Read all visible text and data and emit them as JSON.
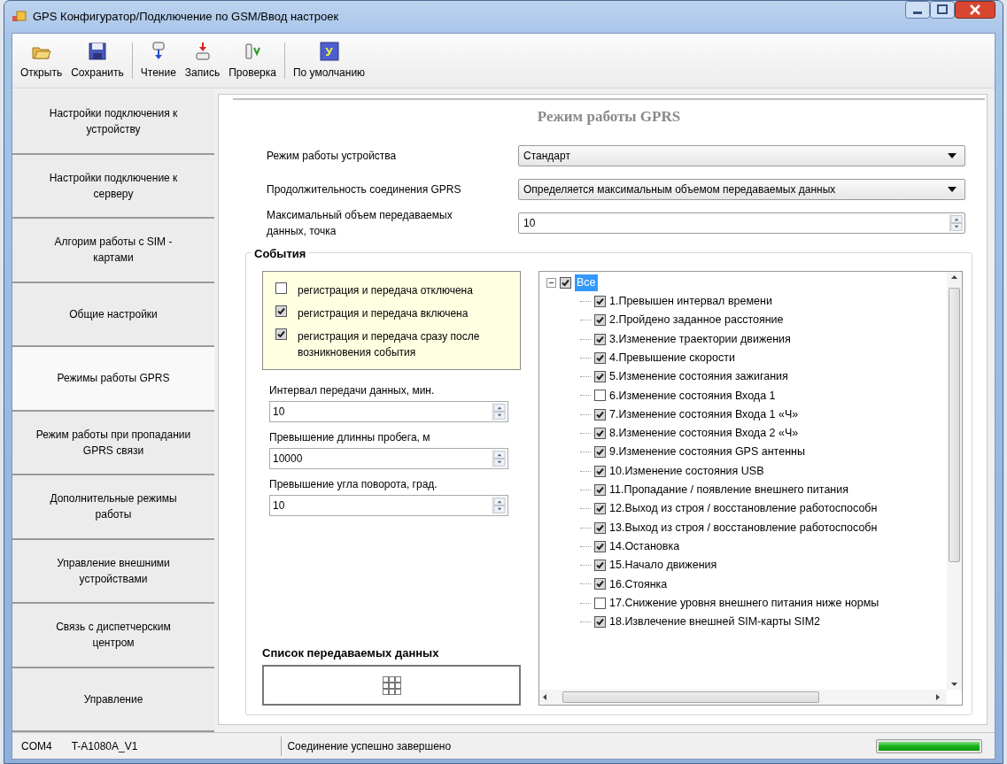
{
  "window": {
    "title": "GPS Конфигуратор/Подключение по GSM/Ввод настроек"
  },
  "toolbar": [
    {
      "kind": "open",
      "label": "Открыть"
    },
    {
      "kind": "save",
      "label": "Сохранить"
    },
    {
      "kind": "separator"
    },
    {
      "kind": "read",
      "label": "Чтение"
    },
    {
      "kind": "write",
      "label": "Запись"
    },
    {
      "kind": "check",
      "label": "Проверка"
    },
    {
      "kind": "separator"
    },
    {
      "kind": "default",
      "label": "По умолчанию",
      "icon_letter": "У"
    }
  ],
  "sidebar": {
    "items": [
      {
        "label": "Настройки подключения к устройству",
        "selected": false
      },
      {
        "label": "Настройки подключение к серверу",
        "selected": false
      },
      {
        "label": "Алгорим работы  с SIM - картами",
        "selected": false
      },
      {
        "label": "Общие настройки",
        "selected": false
      },
      {
        "label": "Режимы работы GPRS",
        "selected": true
      },
      {
        "label": "Режим работы при пропадании GPRS связи",
        "selected": false
      },
      {
        "label": "Дополнительные  режимы работы",
        "selected": false
      },
      {
        "label": "Управление внешними устройствами",
        "selected": false
      },
      {
        "label": "Связь с диспетчерским центром",
        "selected": false
      },
      {
        "label": "Управление",
        "selected": false
      }
    ]
  },
  "panel": {
    "title": "Режим работы GPRS",
    "settings": [
      {
        "kind": "select",
        "label": "Режим работы устройства",
        "value": "Стандарт"
      },
      {
        "kind": "select",
        "label": "Продолжительность соединения GPRS",
        "value": "Определяется максимальным объемом передаваемых данных"
      },
      {
        "kind": "spin",
        "label": "Максимальный объем передаваемых данных, точка",
        "value": "10"
      }
    ],
    "events": {
      "title": "События",
      "modes": [
        {
          "label": "регистрация и передача отключена",
          "checked": false
        },
        {
          "label": "регистрация и передача включена",
          "checked": true
        },
        {
          "label": "регистрация и передача сразу после возникновения события",
          "checked": true
        }
      ],
      "params": [
        {
          "label": "Интервал передачи данных, мин.",
          "value": "10"
        },
        {
          "label": "Превышение длинны пробега, м",
          "value": "10000"
        },
        {
          "label": "Превышение угла поворота, град.",
          "value": "10"
        }
      ],
      "list_title": "Список передаваемых данных",
      "tree": {
        "label": "Все",
        "checked": true,
        "expanded": true,
        "selected": true,
        "children": [
          {
            "label": "1.Превышен интервал времени",
            "checked": true
          },
          {
            "label": "2.Пройдено заданное расстояние",
            "checked": true
          },
          {
            "label": "3.Изменение траектории движения",
            "checked": true
          },
          {
            "label": "4.Превышение скорости",
            "checked": true
          },
          {
            "label": "5.Изменение состояния зажигания",
            "checked": true
          },
          {
            "label": "6.Изменение состояния Входа 1",
            "checked": false
          },
          {
            "label": "7.Изменение состояния Входа 1 «Ч»",
            "checked": true
          },
          {
            "label": "8.Изменение состояния Входа 2 «Ч»",
            "checked": true
          },
          {
            "label": "9.Изменение состояния GPS антенны",
            "checked": true
          },
          {
            "label": "10.Изменение состояния USB",
            "checked": true
          },
          {
            "label": "11.Пропадание / появление внешнего питания",
            "checked": true
          },
          {
            "label": "12.Выход из строя / восстановление работоспособн",
            "checked": true
          },
          {
            "label": "13.Выход из строя / восстановление работоспособн",
            "checked": true
          },
          {
            "label": "14.Остановка",
            "checked": true
          },
          {
            "label": "15.Начало движения",
            "checked": true
          },
          {
            "label": "16.Стоянка",
            "checked": true
          },
          {
            "label": "17.Снижение уровня внешнего питания ниже нормы",
            "checked": false
          },
          {
            "label": "18.Извлечение внешней SIM-карты SIM2",
            "checked": true
          }
        ]
      }
    }
  },
  "status_bar": {
    "port": "COM4",
    "device": "T-A1080A_V1",
    "message": "Соединение успешно завершено",
    "progress": {
      "level": 1
    }
  }
}
